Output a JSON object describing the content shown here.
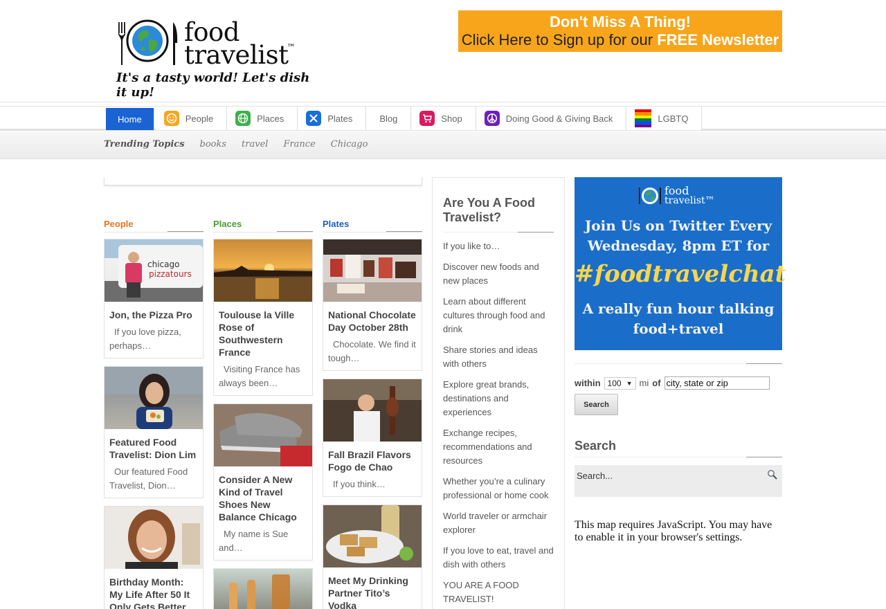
{
  "logo": {
    "name": "food travelist",
    "tm": "™",
    "tagline": "It's a tasty world! Let's dish it up!"
  },
  "newsletter": {
    "line1": "Don't Miss A Thing!",
    "line2_prefix": "Click Here to Sign up for our",
    "line2_emphasis": "FREE Newsletter"
  },
  "nav": {
    "items": [
      {
        "label": "Home",
        "icon": "",
        "color": ""
      },
      {
        "label": "People",
        "icon": "smiley-icon",
        "color": "#f5a623"
      },
      {
        "label": "Places",
        "icon": "globe-icon",
        "color": "#3db04a"
      },
      {
        "label": "Plates",
        "icon": "fork-knife-icon",
        "color": "#1a6ed8"
      },
      {
        "label": "Blog",
        "icon": "",
        "color": ""
      },
      {
        "label": "Shop",
        "icon": "cart-icon",
        "color": "#d81b60"
      },
      {
        "label": "Doing Good & Giving Back",
        "icon": "peace-icon",
        "color": "#6a1fbf"
      },
      {
        "label": "LGBTQ",
        "icon": "rainbow-flag-icon",
        "color": ""
      }
    ]
  },
  "trending": {
    "label": "Trending Topics",
    "topics": [
      "books",
      "travel",
      "France",
      "Chicago"
    ]
  },
  "columns": [
    {
      "heading": "People",
      "color": "#e8751a",
      "posts": [
        {
          "title": "Jon, the Pizza Pro",
          "excerpt": "If you love pizza, perhaps…",
          "image": "pizza-tour-van-photo"
        },
        {
          "title": "Featured Food Travelist: Dion Lim",
          "excerpt": "Our featured Food Travelist, Dion…",
          "image": "woman-holding-food-photo"
        },
        {
          "title": "Birthday Month: My Life After 50 It Only Gets Better",
          "excerpt": "",
          "image": "woman-portrait-photo"
        }
      ]
    },
    {
      "heading": "Places",
      "color": "#4c9c2e",
      "posts": [
        {
          "title": "Toulouse la Ville Rose of Southwestern France",
          "excerpt": "Visiting France has always been…",
          "image": "sunset-river-photo"
        },
        {
          "title": "Consider A New Kind of Travel Shoes New Balance Chicago",
          "excerpt": "My name is Sue and…",
          "image": "sneakers-photo"
        },
        {
          "title": "",
          "excerpt": "",
          "image": "skewers-drinks-photo"
        }
      ]
    },
    {
      "heading": "Plates",
      "color": "#1a5fbf",
      "posts": [
        {
          "title": "National Chocolate Day October 28th",
          "excerpt": "Chocolate. We find it tough…",
          "image": "chocolate-products-photo"
        },
        {
          "title": "Fall Brazil Flavors Fogo de Chao",
          "excerpt": "If you think…",
          "image": "chef-meat-photo"
        },
        {
          "title": "Meet My Drinking Partner Tito’s Vodka",
          "excerpt": "",
          "image": "bread-and-drink-photo"
        }
      ]
    }
  ],
  "about": {
    "title": "Are You A Food Travelist?",
    "items": [
      "If you like to…",
      "Discover new foods and new places",
      "Learn about different cultures through food and drink",
      "Share stories and ideas with others",
      "Explore great brands, destinations and experiences",
      "Exchange recipes, recommendations and resources",
      "Whether you’re a culinary professional or home cook",
      "World traveler or armchair explorer",
      "If you love to eat, travel and dish with others",
      "YOU ARE A FOOD TRAVELIST!"
    ]
  },
  "twitter_ad": {
    "logo_line1": "food",
    "logo_line2": "travelist™",
    "line1": "Join Us on Twitter Every",
    "line2": "Wednesday, 8pm ET for",
    "hashtag": "#foodtravelchat",
    "line3": "A really fun hour talking",
    "line4": "food+travel"
  },
  "locator": {
    "within_label": "within",
    "distance": "100",
    "unit": "mi",
    "of_label": "of",
    "placeholder": "city, state or zip",
    "button": "Search"
  },
  "search": {
    "heading": "Search",
    "placeholder": "Search..."
  },
  "map_message": "This map requires JavaScript. You may have to enable it in your browser's settings."
}
